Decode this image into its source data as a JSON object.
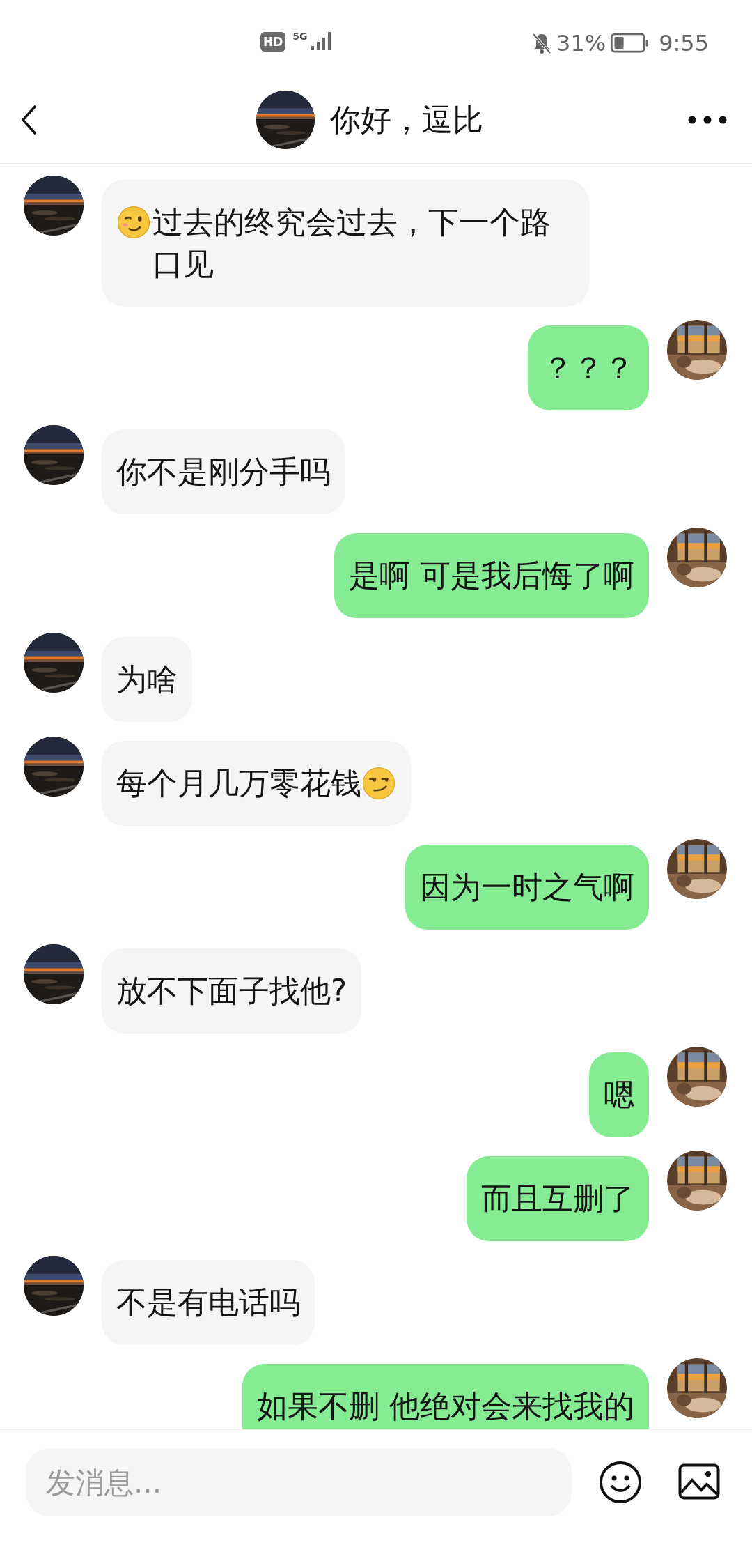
{
  "status_bar": {
    "hd_badge": "HD",
    "network": "5G",
    "battery": "31%",
    "time": "9:55"
  },
  "header": {
    "title": "你好，逗比"
  },
  "messages": [
    {
      "kind": "incoming",
      "text": "过去的终究会过去，下一个路口见",
      "leading_emoji": {
        "kind": "wink"
      }
    },
    {
      "kind": "outgoing",
      "text": "？？？"
    },
    {
      "kind": "incoming",
      "text": "你不是刚分手吗"
    },
    {
      "kind": "outgoing",
      "text": "是啊 可是我后悔了啊"
    },
    {
      "kind": "incoming",
      "text": "为啥"
    },
    {
      "kind": "incoming",
      "text": "每个月几万零花钱",
      "trailing_emoji": {
        "kind": "smirk"
      }
    },
    {
      "kind": "outgoing",
      "text": "因为一时之气啊"
    },
    {
      "kind": "incoming",
      "text": "放不下面子找他?"
    },
    {
      "kind": "outgoing",
      "text": "嗯"
    },
    {
      "kind": "outgoing",
      "text": "而且互删了"
    },
    {
      "kind": "incoming",
      "text": "不是有电话吗"
    },
    {
      "kind": "outgoing",
      "text": "如果不删 他绝对会来找我的"
    }
  ],
  "composer": {
    "placeholder": "发消息..."
  }
}
